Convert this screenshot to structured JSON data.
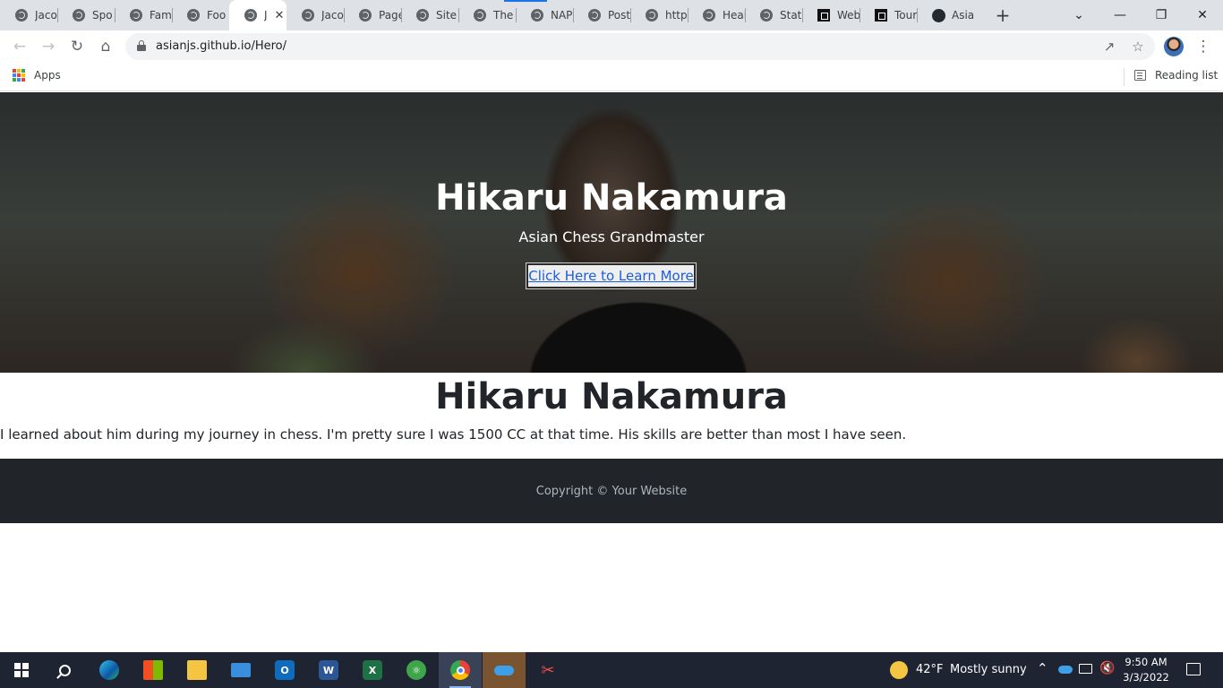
{
  "browser": {
    "tabs": [
      {
        "title": "Jaco",
        "icon": "globe"
      },
      {
        "title": "Spo",
        "icon": "globe"
      },
      {
        "title": "Fam",
        "icon": "globe"
      },
      {
        "title": "Foo",
        "icon": "globe"
      },
      {
        "title": "J",
        "icon": "globe",
        "active": true
      },
      {
        "title": "Jaco",
        "icon": "globe"
      },
      {
        "title": "Page",
        "icon": "globe"
      },
      {
        "title": "Site",
        "icon": "globe"
      },
      {
        "title": "The",
        "icon": "globe"
      },
      {
        "title": "NAP",
        "icon": "globe"
      },
      {
        "title": "Post",
        "icon": "globe"
      },
      {
        "title": "http",
        "icon": "globe"
      },
      {
        "title": "Heal",
        "icon": "globe"
      },
      {
        "title": "State",
        "icon": "globe"
      },
      {
        "title": "Web",
        "icon": "square"
      },
      {
        "title": "Tour",
        "icon": "square"
      },
      {
        "title": "Asia",
        "icon": "github"
      }
    ],
    "new_tab_label": "+",
    "url": "asianjs.github.io/Hero/",
    "bookmarks": {
      "apps_label": "Apps",
      "reading_list_label": "Reading list"
    },
    "accent_color": "#1a73e8"
  },
  "page": {
    "hero": {
      "title": "Hikaru Nakamura",
      "subtitle": "Asian Chess Grandmaster",
      "button_label": "Click Here to Learn More"
    },
    "section": {
      "title": "Hikaru Nakamura",
      "text": "I learned about him during my journey in chess. I'm pretty sure I was 1500 CC at that time. His skills are better than most I have seen."
    },
    "footer": {
      "text": "Copyright © Your Website"
    }
  },
  "taskbar": {
    "apps": [
      "start",
      "search",
      "edge",
      "store",
      "file-explorer",
      "mail",
      "outlook",
      "word",
      "excel",
      "atom",
      "chrome",
      "onedrive",
      "snipping-tool"
    ],
    "weather": {
      "temp": "42°F",
      "condition": "Mostly sunny"
    },
    "clock": {
      "time": "9:50 AM",
      "date": "3/3/2022"
    }
  }
}
